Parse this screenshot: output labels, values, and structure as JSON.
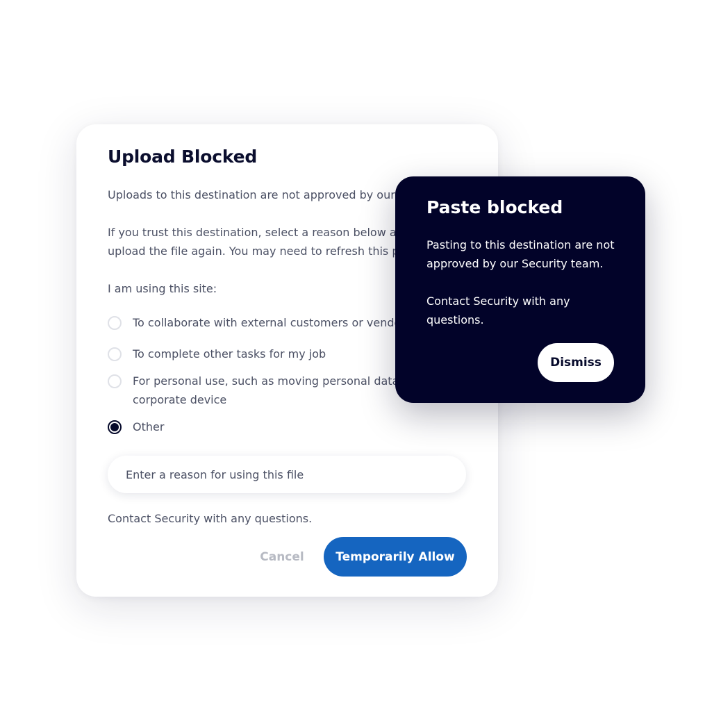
{
  "upload_dialog": {
    "title": "Upload Blocked",
    "paragraph_1": "Uploads to this destination are not approved by our",
    "paragraph_2_line_1": "If you trust this destination, select a reason below an",
    "paragraph_2_line_2": "upload the file again. You may need to refresh this p",
    "prompt": "I am using this site:",
    "options": [
      {
        "label": "To collaborate with external customers or vendo",
        "checked": false
      },
      {
        "label": "To complete other tasks for my job",
        "checked": false
      },
      {
        "label_line_1": "For personal use, such as moving personal data",
        "label_line_2": "corporate device",
        "checked": false
      },
      {
        "label": "Other",
        "checked": true
      }
    ],
    "reason_input": {
      "placeholder": "Enter a reason for using this file",
      "value": ""
    },
    "contact_text": "Contact Security with any questions.",
    "cancel_label": "Cancel",
    "allow_label": "Temporarily Allow",
    "colors": {
      "title": "#0b0e2e",
      "body_text": "#4b5064",
      "primary_button": "#1565c0",
      "cancel_text": "#b7bac3",
      "radio_checked": "#060a2b"
    }
  },
  "paste_toast": {
    "title": "Paste blocked",
    "message_1": "Pasting to this destination are not\napproved by our Security team.",
    "message_2": "Contact Security with any\nquestions.",
    "dismiss_label": "Dismiss",
    "colors": {
      "background": "#020329",
      "text": "#ffffff",
      "button_bg": "#ffffff"
    }
  }
}
